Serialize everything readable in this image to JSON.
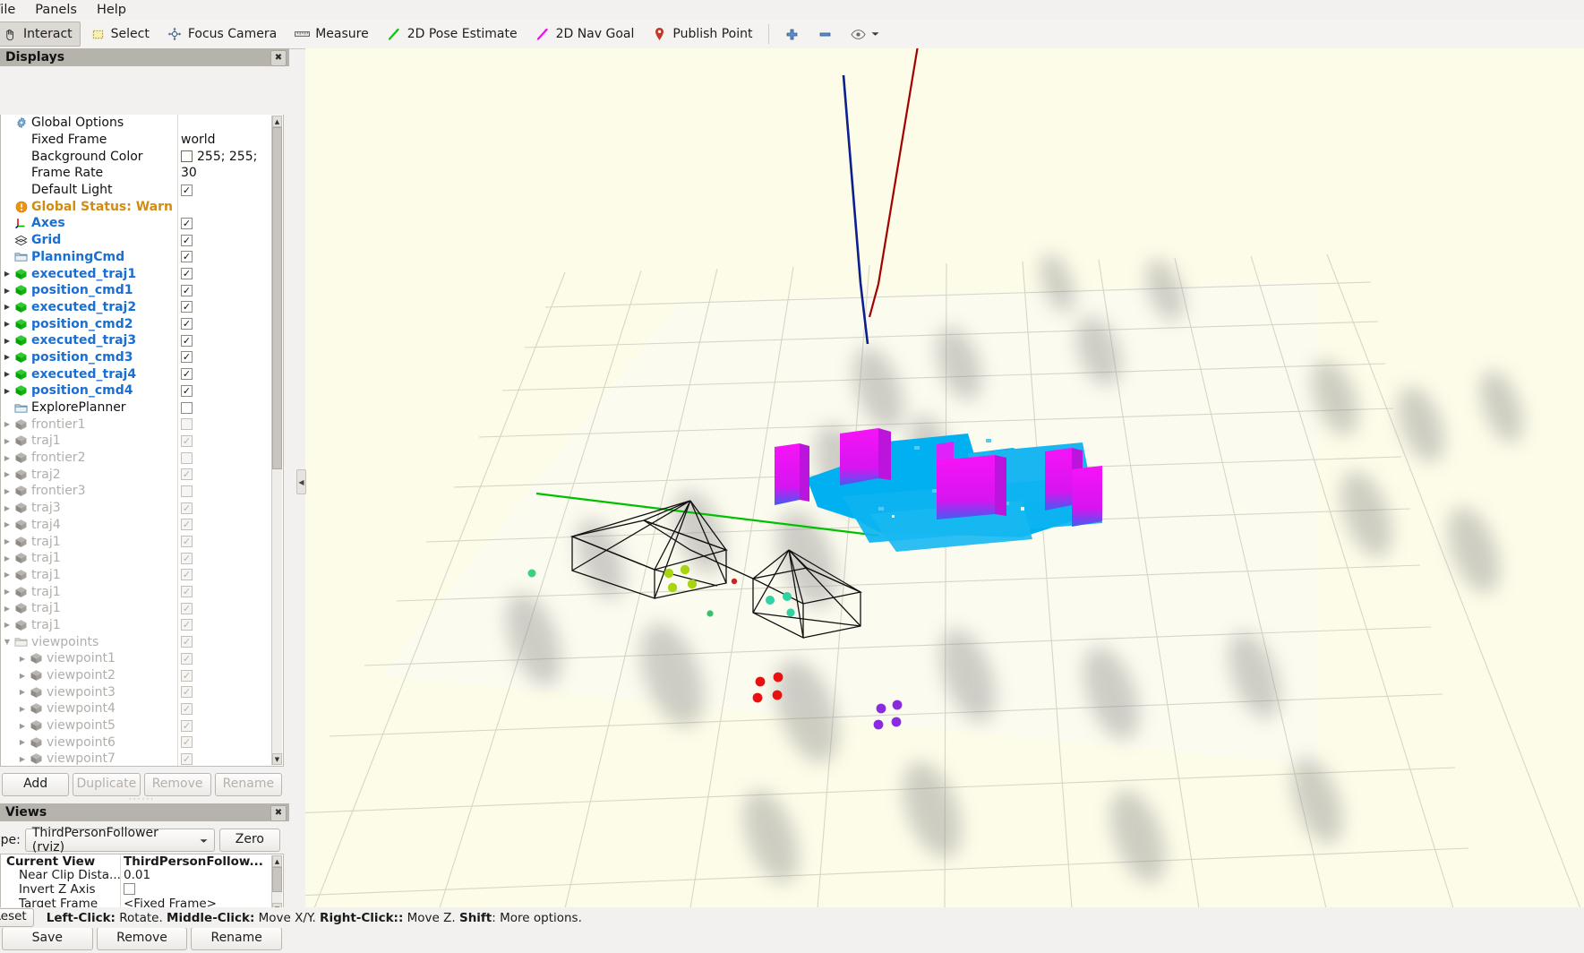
{
  "menu": {
    "items": [
      {
        "label": "File",
        "mnemonic": "F"
      },
      {
        "label": "Panels",
        "mnemonic": "P"
      },
      {
        "label": "Help",
        "mnemonic": "H"
      }
    ]
  },
  "toolbar": {
    "buttons": [
      {
        "label": "Interact",
        "icon": "hand-interact-icon",
        "active": true
      },
      {
        "label": "Select",
        "icon": "dashed-square-select-icon",
        "active": false
      },
      {
        "label": "Focus Camera",
        "icon": "focus-crosshair-icon",
        "active": false
      },
      {
        "label": "Measure",
        "icon": "ruler-icon",
        "active": false
      },
      {
        "label": "2D Pose Estimate",
        "icon": "green-arrow-icon",
        "active": false
      },
      {
        "label": "2D Nav Goal",
        "icon": "magenta-arrow-icon",
        "active": false
      },
      {
        "label": "Publish Point",
        "icon": "map-pin-icon",
        "active": false
      }
    ],
    "extra": [
      {
        "icon": "plus-icon",
        "label": "+"
      },
      {
        "icon": "minus-icon",
        "label": "-"
      },
      {
        "icon": "eye-icon",
        "label": "eye"
      },
      {
        "icon": "chevron-down-icon",
        "label": "more"
      }
    ]
  },
  "displays_panel": {
    "title": "Displays",
    "close_label": "✖",
    "rows": [
      {
        "label": "Global Options",
        "icon": "gear-icon",
        "style": "plain",
        "indent": 0,
        "arrow": "none",
        "control": "none"
      },
      {
        "label": "Fixed Frame",
        "icon": "none",
        "style": "plain",
        "indent": 1,
        "arrow": "none",
        "control": "text",
        "value": "world"
      },
      {
        "label": "Background Color",
        "icon": "none",
        "style": "plain",
        "indent": 1,
        "arrow": "none",
        "control": "color",
        "value": "255; 255;",
        "color": "#fffffa"
      },
      {
        "label": "Frame Rate",
        "icon": "none",
        "style": "plain",
        "indent": 1,
        "arrow": "none",
        "control": "text",
        "value": "30"
      },
      {
        "label": "Default Light",
        "icon": "none",
        "style": "plain",
        "indent": 1,
        "arrow": "none",
        "control": "check"
      },
      {
        "label": "Global Status: Warn",
        "icon": "warning-icon",
        "style": "warn",
        "indent": 0,
        "arrow": "none",
        "control": "none"
      },
      {
        "label": "Axes",
        "icon": "axes-icon",
        "style": "blue",
        "indent": 0,
        "arrow": "none",
        "control": "check"
      },
      {
        "label": "Grid",
        "icon": "grid-icon",
        "style": "blue",
        "indent": 0,
        "arrow": "none",
        "control": "check"
      },
      {
        "label": "PlanningCmd",
        "icon": "folder-icon",
        "style": "blue",
        "indent": 0,
        "arrow": "none",
        "control": "check"
      },
      {
        "label": "executed_traj1",
        "icon": "green-cube-icon",
        "style": "blue",
        "indent": 1,
        "arrow": "right",
        "control": "check"
      },
      {
        "label": "position_cmd1",
        "icon": "green-cube-icon",
        "style": "blue",
        "indent": 1,
        "arrow": "right",
        "control": "check"
      },
      {
        "label": "executed_traj2",
        "icon": "green-cube-icon",
        "style": "blue",
        "indent": 1,
        "arrow": "right",
        "control": "check"
      },
      {
        "label": "position_cmd2",
        "icon": "green-cube-icon",
        "style": "blue",
        "indent": 1,
        "arrow": "right",
        "control": "check"
      },
      {
        "label": "executed_traj3",
        "icon": "green-cube-icon",
        "style": "blue",
        "indent": 1,
        "arrow": "right",
        "control": "check"
      },
      {
        "label": "position_cmd3",
        "icon": "green-cube-icon",
        "style": "blue",
        "indent": 1,
        "arrow": "right",
        "control": "check"
      },
      {
        "label": "executed_traj4",
        "icon": "green-cube-icon",
        "style": "blue",
        "indent": 1,
        "arrow": "right",
        "control": "check"
      },
      {
        "label": "position_cmd4",
        "icon": "green-cube-icon",
        "style": "blue",
        "indent": 1,
        "arrow": "right",
        "control": "check"
      },
      {
        "label": "ExplorePlanner",
        "icon": "folder-icon",
        "style": "plain",
        "indent": 0,
        "arrow": "none",
        "control": "uncheck"
      },
      {
        "label": "frontier1",
        "icon": "gray-cube-icon",
        "style": "dim",
        "indent": 1,
        "arrow": "right-dim",
        "control": "uncheck-dim"
      },
      {
        "label": "traj1",
        "icon": "gray-cube-icon",
        "style": "dim",
        "indent": 1,
        "arrow": "right-dim",
        "control": "check-dim"
      },
      {
        "label": "frontier2",
        "icon": "gray-cube-icon",
        "style": "dim",
        "indent": 1,
        "arrow": "right-dim",
        "control": "uncheck-dim"
      },
      {
        "label": "traj2",
        "icon": "gray-cube-icon",
        "style": "dim",
        "indent": 1,
        "arrow": "right-dim",
        "control": "check-dim"
      },
      {
        "label": "frontier3",
        "icon": "gray-cube-icon",
        "style": "dim",
        "indent": 1,
        "arrow": "right-dim",
        "control": "uncheck-dim"
      },
      {
        "label": "traj3",
        "icon": "gray-cube-icon",
        "style": "dim",
        "indent": 1,
        "arrow": "right-dim",
        "control": "check-dim"
      },
      {
        "label": "traj4",
        "icon": "gray-cube-icon",
        "style": "dim",
        "indent": 1,
        "arrow": "right-dim",
        "control": "check-dim"
      },
      {
        "label": "traj1",
        "icon": "gray-cube-icon",
        "style": "dim",
        "indent": 1,
        "arrow": "right-dim",
        "control": "check-dim"
      },
      {
        "label": "traj1",
        "icon": "gray-cube-icon",
        "style": "dim",
        "indent": 1,
        "arrow": "right-dim",
        "control": "check-dim"
      },
      {
        "label": "traj1",
        "icon": "gray-cube-icon",
        "style": "dim",
        "indent": 1,
        "arrow": "right-dim",
        "control": "check-dim"
      },
      {
        "label": "traj1",
        "icon": "gray-cube-icon",
        "style": "dim",
        "indent": 1,
        "arrow": "right-dim",
        "control": "check-dim"
      },
      {
        "label": "traj1",
        "icon": "gray-cube-icon",
        "style": "dim",
        "indent": 1,
        "arrow": "right-dim",
        "control": "check-dim"
      },
      {
        "label": "traj1",
        "icon": "gray-cube-icon",
        "style": "dim",
        "indent": 1,
        "arrow": "right-dim",
        "control": "check-dim"
      },
      {
        "label": "viewpoints",
        "icon": "folder-dim-icon",
        "style": "dim",
        "indent": 1,
        "arrow": "down-dim",
        "control": "check-dim"
      },
      {
        "label": "viewpoint1",
        "icon": "gray-cube-icon",
        "style": "dim",
        "indent": 2,
        "arrow": "right-dim",
        "control": "check-dim"
      },
      {
        "label": "viewpoint2",
        "icon": "gray-cube-icon",
        "style": "dim",
        "indent": 2,
        "arrow": "right-dim",
        "control": "check-dim"
      },
      {
        "label": "viewpoint3",
        "icon": "gray-cube-icon",
        "style": "dim",
        "indent": 2,
        "arrow": "right-dim",
        "control": "check-dim"
      },
      {
        "label": "viewpoint4",
        "icon": "gray-cube-icon",
        "style": "dim",
        "indent": 2,
        "arrow": "right-dim",
        "control": "check-dim"
      },
      {
        "label": "viewpoint5",
        "icon": "gray-cube-icon",
        "style": "dim",
        "indent": 2,
        "arrow": "right-dim",
        "control": "check-dim"
      },
      {
        "label": "viewpoint6",
        "icon": "gray-cube-icon",
        "style": "dim",
        "indent": 2,
        "arrow": "right-dim",
        "control": "check-dim"
      },
      {
        "label": "viewpoint7",
        "icon": "gray-cube-icon",
        "style": "dim",
        "indent": 2,
        "arrow": "right-dim",
        "control": "check-dim"
      }
    ],
    "buttons": [
      {
        "label": "Add",
        "enabled": true
      },
      {
        "label": "Duplicate",
        "enabled": false
      },
      {
        "label": "Remove",
        "enabled": false
      },
      {
        "label": "Rename",
        "enabled": false
      }
    ]
  },
  "views_panel": {
    "title": "Views",
    "close_label": "✖",
    "type_label": "Type:",
    "type_value": "ThirdPersonFollower (rviz)",
    "zero_label": "Zero",
    "properties": [
      {
        "key": "Current View",
        "value": "ThirdPersonFollow...",
        "control": "text",
        "header": true
      },
      {
        "key": "Near Clip Dista...",
        "value": "0.01",
        "control": "text",
        "header": false
      },
      {
        "key": "Invert Z Axis",
        "value": "",
        "control": "uncheck",
        "header": false
      },
      {
        "key": "Target Frame",
        "value": "<Fixed Frame>",
        "control": "text",
        "header": false
      }
    ],
    "buttons": [
      {
        "label": "Save"
      },
      {
        "label": "Remove"
      },
      {
        "label": "Rename"
      }
    ]
  },
  "status_bar": {
    "reset_label": "Reset",
    "hint_segments": [
      {
        "text": "Left-Click:",
        "bold": true
      },
      {
        "text": " Rotate. ",
        "bold": false
      },
      {
        "text": "Middle-Click:",
        "bold": true
      },
      {
        "text": " Move X/Y. ",
        "bold": false
      },
      {
        "text": "Right-Click::",
        "bold": true
      },
      {
        "text": " Move Z. ",
        "bold": false
      },
      {
        "text": "Shift",
        "bold": true
      },
      {
        "text": ": More options.",
        "bold": false
      }
    ]
  },
  "viewport": {
    "name": "3d-render-view",
    "background_color": "#fdfce9",
    "grid_color": "#d2d0c2",
    "scene_elements": {
      "pointcloud_primary_color": "#00b0f0",
      "pointcloud_secondary_color": "#f713f7",
      "trajectory_colors": [
        "#0b1f8f",
        "#a30000",
        "#00a000"
      ],
      "marker_colors": [
        "#e81010",
        "#8a2be2",
        "#a0d000",
        "#2fd2a0"
      ],
      "frustum_color": "#101010"
    }
  }
}
